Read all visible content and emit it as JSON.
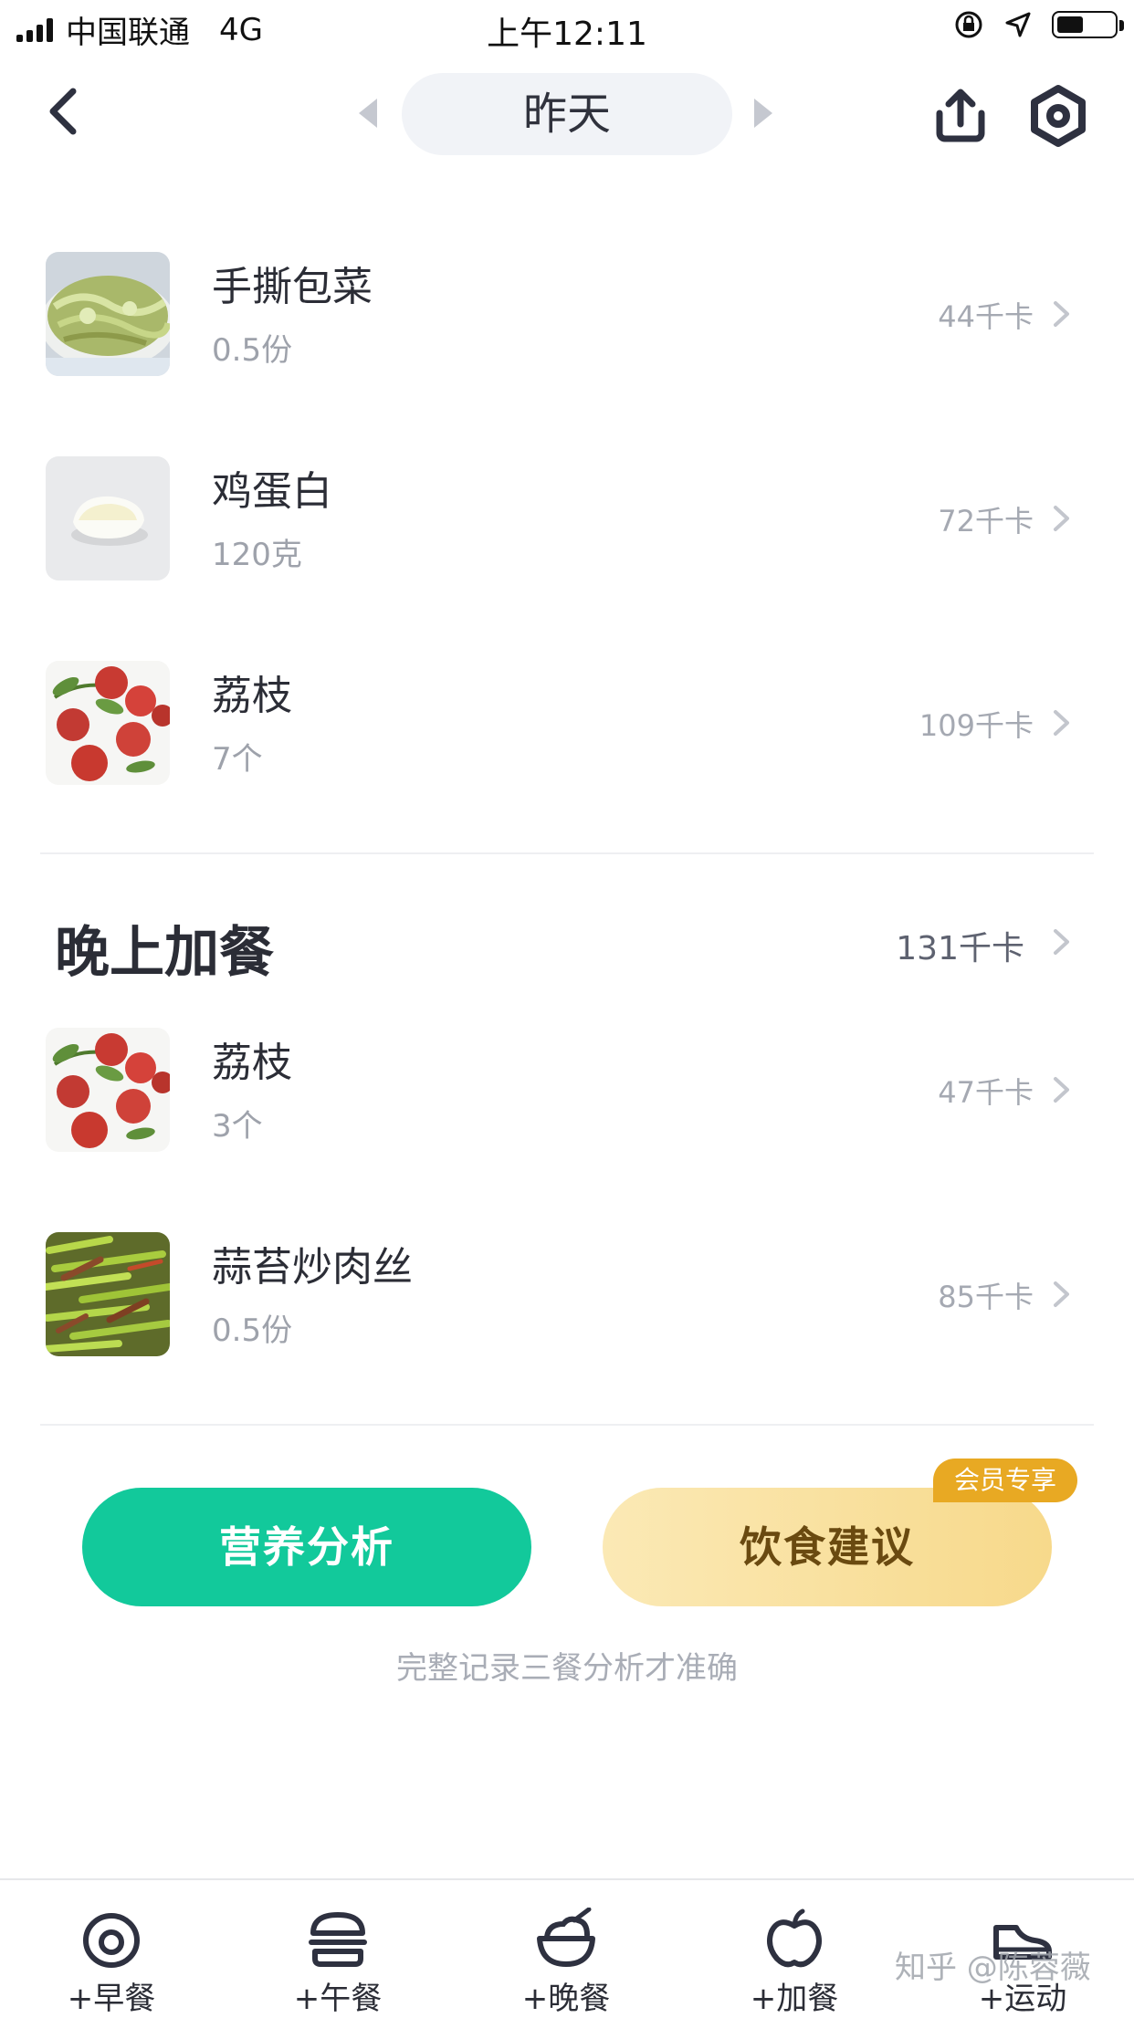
{
  "status_bar": {
    "carrier": "中国联通",
    "network": "4G",
    "time": "上午12:11"
  },
  "header": {
    "date_label": "昨天"
  },
  "foods_top": [
    {
      "name": "手撕包菜",
      "amount": "0.5份",
      "kcal": "44千卡",
      "thumb": "cabbage"
    },
    {
      "name": "鸡蛋白",
      "amount": "120克",
      "kcal": "72千卡",
      "thumb": "egg"
    },
    {
      "name": "荔枝",
      "amount": "7个",
      "kcal": "109千卡",
      "thumb": "lychee"
    }
  ],
  "section": {
    "title": "晚上加餐",
    "kcal": "131千卡",
    "items": [
      {
        "name": "荔枝",
        "amount": "3个",
        "kcal": "47千卡",
        "thumb": "lychee"
      },
      {
        "name": "蒜苔炒肉丝",
        "amount": "0.5份",
        "kcal": "85千卡",
        "thumb": "garlic-stems"
      }
    ]
  },
  "actions": {
    "analysis_label": "营养分析",
    "advice_label": "饮食建议",
    "vip_badge": "会员专享",
    "hint": "完整记录三餐分析才准确"
  },
  "tabbar": [
    {
      "label": "+早餐",
      "icon": "egg-icon"
    },
    {
      "label": "+午餐",
      "icon": "burger-icon"
    },
    {
      "label": "+晚餐",
      "icon": "bowl-icon"
    },
    {
      "label": "+加餐",
      "icon": "apple-icon"
    },
    {
      "label": "+运动",
      "icon": "shoe-icon"
    }
  ],
  "watermark": "知乎 @陈蓉薇",
  "colors": {
    "accent_green": "#12c99b",
    "vip_gold": "#e8a923",
    "advice_bg": "#f7d98b"
  }
}
